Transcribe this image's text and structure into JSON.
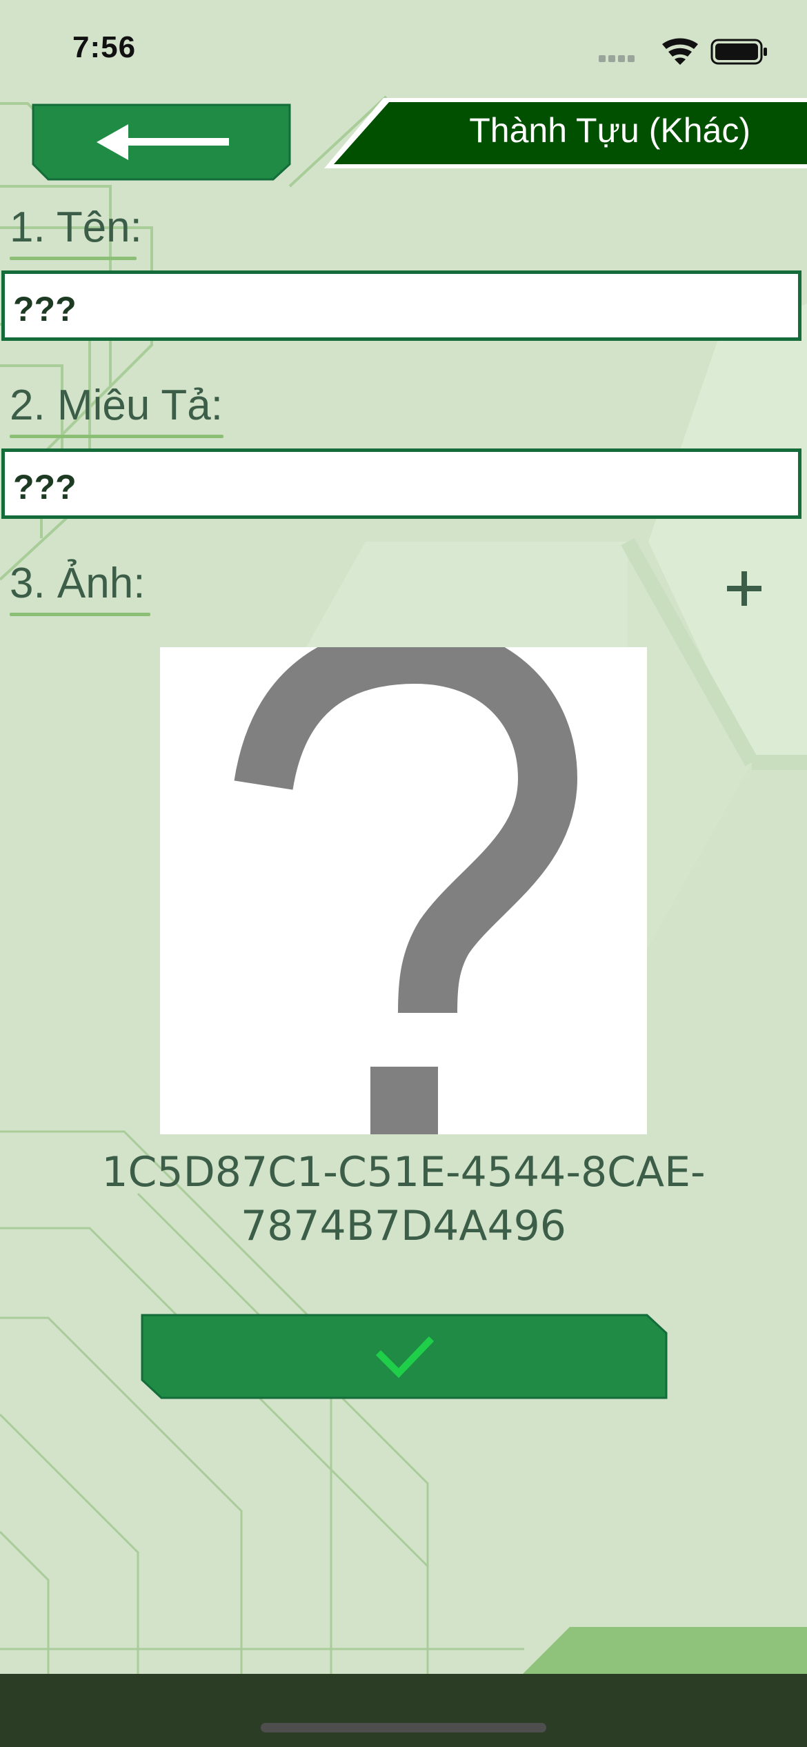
{
  "status_bar": {
    "time": "7:56"
  },
  "header": {
    "back_icon": "left-arrow-icon",
    "title": "Thành Tựu (Khác)"
  },
  "form": {
    "name": {
      "label": "1. Tên:",
      "value": "???"
    },
    "description": {
      "label": "2. Miêu Tả:",
      "value": "???"
    },
    "image": {
      "label": "3. Ảnh:",
      "add_icon": "plus-icon",
      "placeholder_icon": "question-mark-icon",
      "image_id": "1C5D87C1-C51E-4544-8CAE-7874B7D4A496"
    }
  },
  "confirm": {
    "icon": "checkmark-icon"
  },
  "colors": {
    "background": "#d2e3c9",
    "primary_green": "#1f8b44",
    "banner_green": "#005000",
    "label_text": "#3c5e48",
    "field_border": "#136c3a",
    "bottom_bar": "#2c3d25",
    "check_green": "#1fcf4a"
  }
}
